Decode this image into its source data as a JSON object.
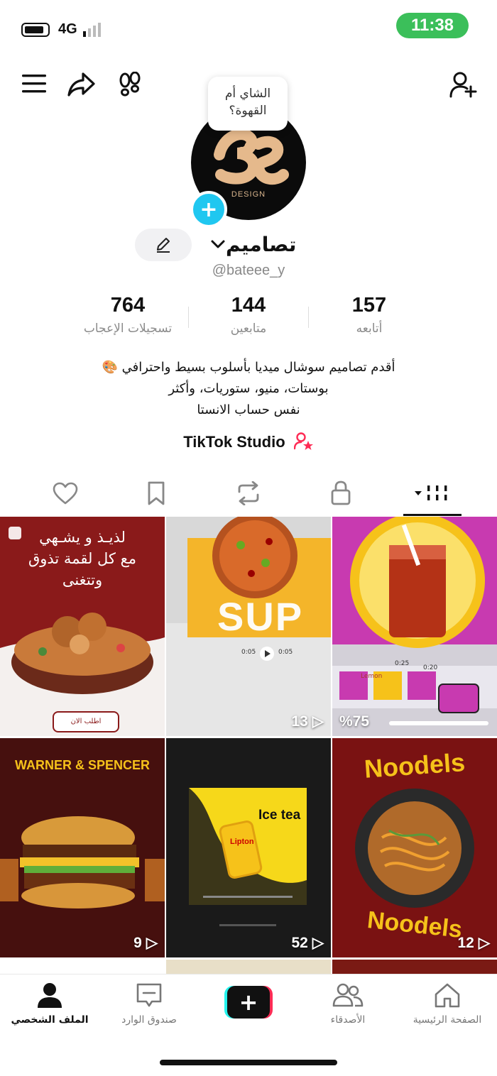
{
  "status_bar": {
    "time": "11:38",
    "network": "4G"
  },
  "header": {
    "bubble_text": "الشاي أم القهوة؟",
    "avatar_logo_text": "DESIGN"
  },
  "profile": {
    "display_name": "تصاميم",
    "handle": "@bateee_y",
    "stats": [
      {
        "value": "157",
        "label": "أتابعه"
      },
      {
        "value": "144",
        "label": "متابعين"
      },
      {
        "value": "764",
        "label": "تسجيلات الإعجاب"
      }
    ],
    "bio_lines": [
      "أقدم تصاميم سوشال ميديا بأسلوب بسيط واحترافي 🎨",
      "بوستات، منيو، ستوريات، وأكثر",
      "نفس حساب الانستا"
    ],
    "studio_link": "TikTok Studio"
  },
  "tabs": [
    "videos",
    "private",
    "reposts",
    "saved",
    "liked"
  ],
  "grid": [
    {
      "id": "tile-1",
      "title_lines": [
        "لذيـذ و يشـهي",
        "مع كل لقمة تذوق",
        "وتتغنى"
      ],
      "button": "اطلب الان",
      "count": ""
    },
    {
      "id": "tile-2",
      "title_lines": [
        "SUP"
      ],
      "times": [
        "0:05",
        "0:05"
      ],
      "count": "13"
    },
    {
      "id": "tile-3",
      "title_lines": [
        "Lemon"
      ],
      "times": [
        "0:25",
        "0:20"
      ],
      "count": "%75"
    },
    {
      "id": "tile-4",
      "title_lines": [
        "WARNER & SPENCER"
      ],
      "count": "9"
    },
    {
      "id": "tile-5",
      "title_lines": [
        "Ice tea",
        "Lipton"
      ],
      "count": "52"
    },
    {
      "id": "tile-6",
      "title_lines": [
        "Noodels",
        "Noodels"
      ],
      "count": "12"
    }
  ],
  "bottom_nav": [
    {
      "label": "الصفحة الرئيسية",
      "icon": "home-icon"
    },
    {
      "label": "الأصدقاء",
      "icon": "friends-icon"
    },
    {
      "label": "",
      "icon": "plus-icon"
    },
    {
      "label": "صندوق الوارد",
      "icon": "inbox-icon"
    },
    {
      "label": "الملف الشخصي",
      "icon": "profile-icon"
    }
  ],
  "colors": {
    "accent": "#20c7f0",
    "status_green": "#3bbf5a",
    "pink": "#fe2c55",
    "cyan": "#25f4ee"
  }
}
